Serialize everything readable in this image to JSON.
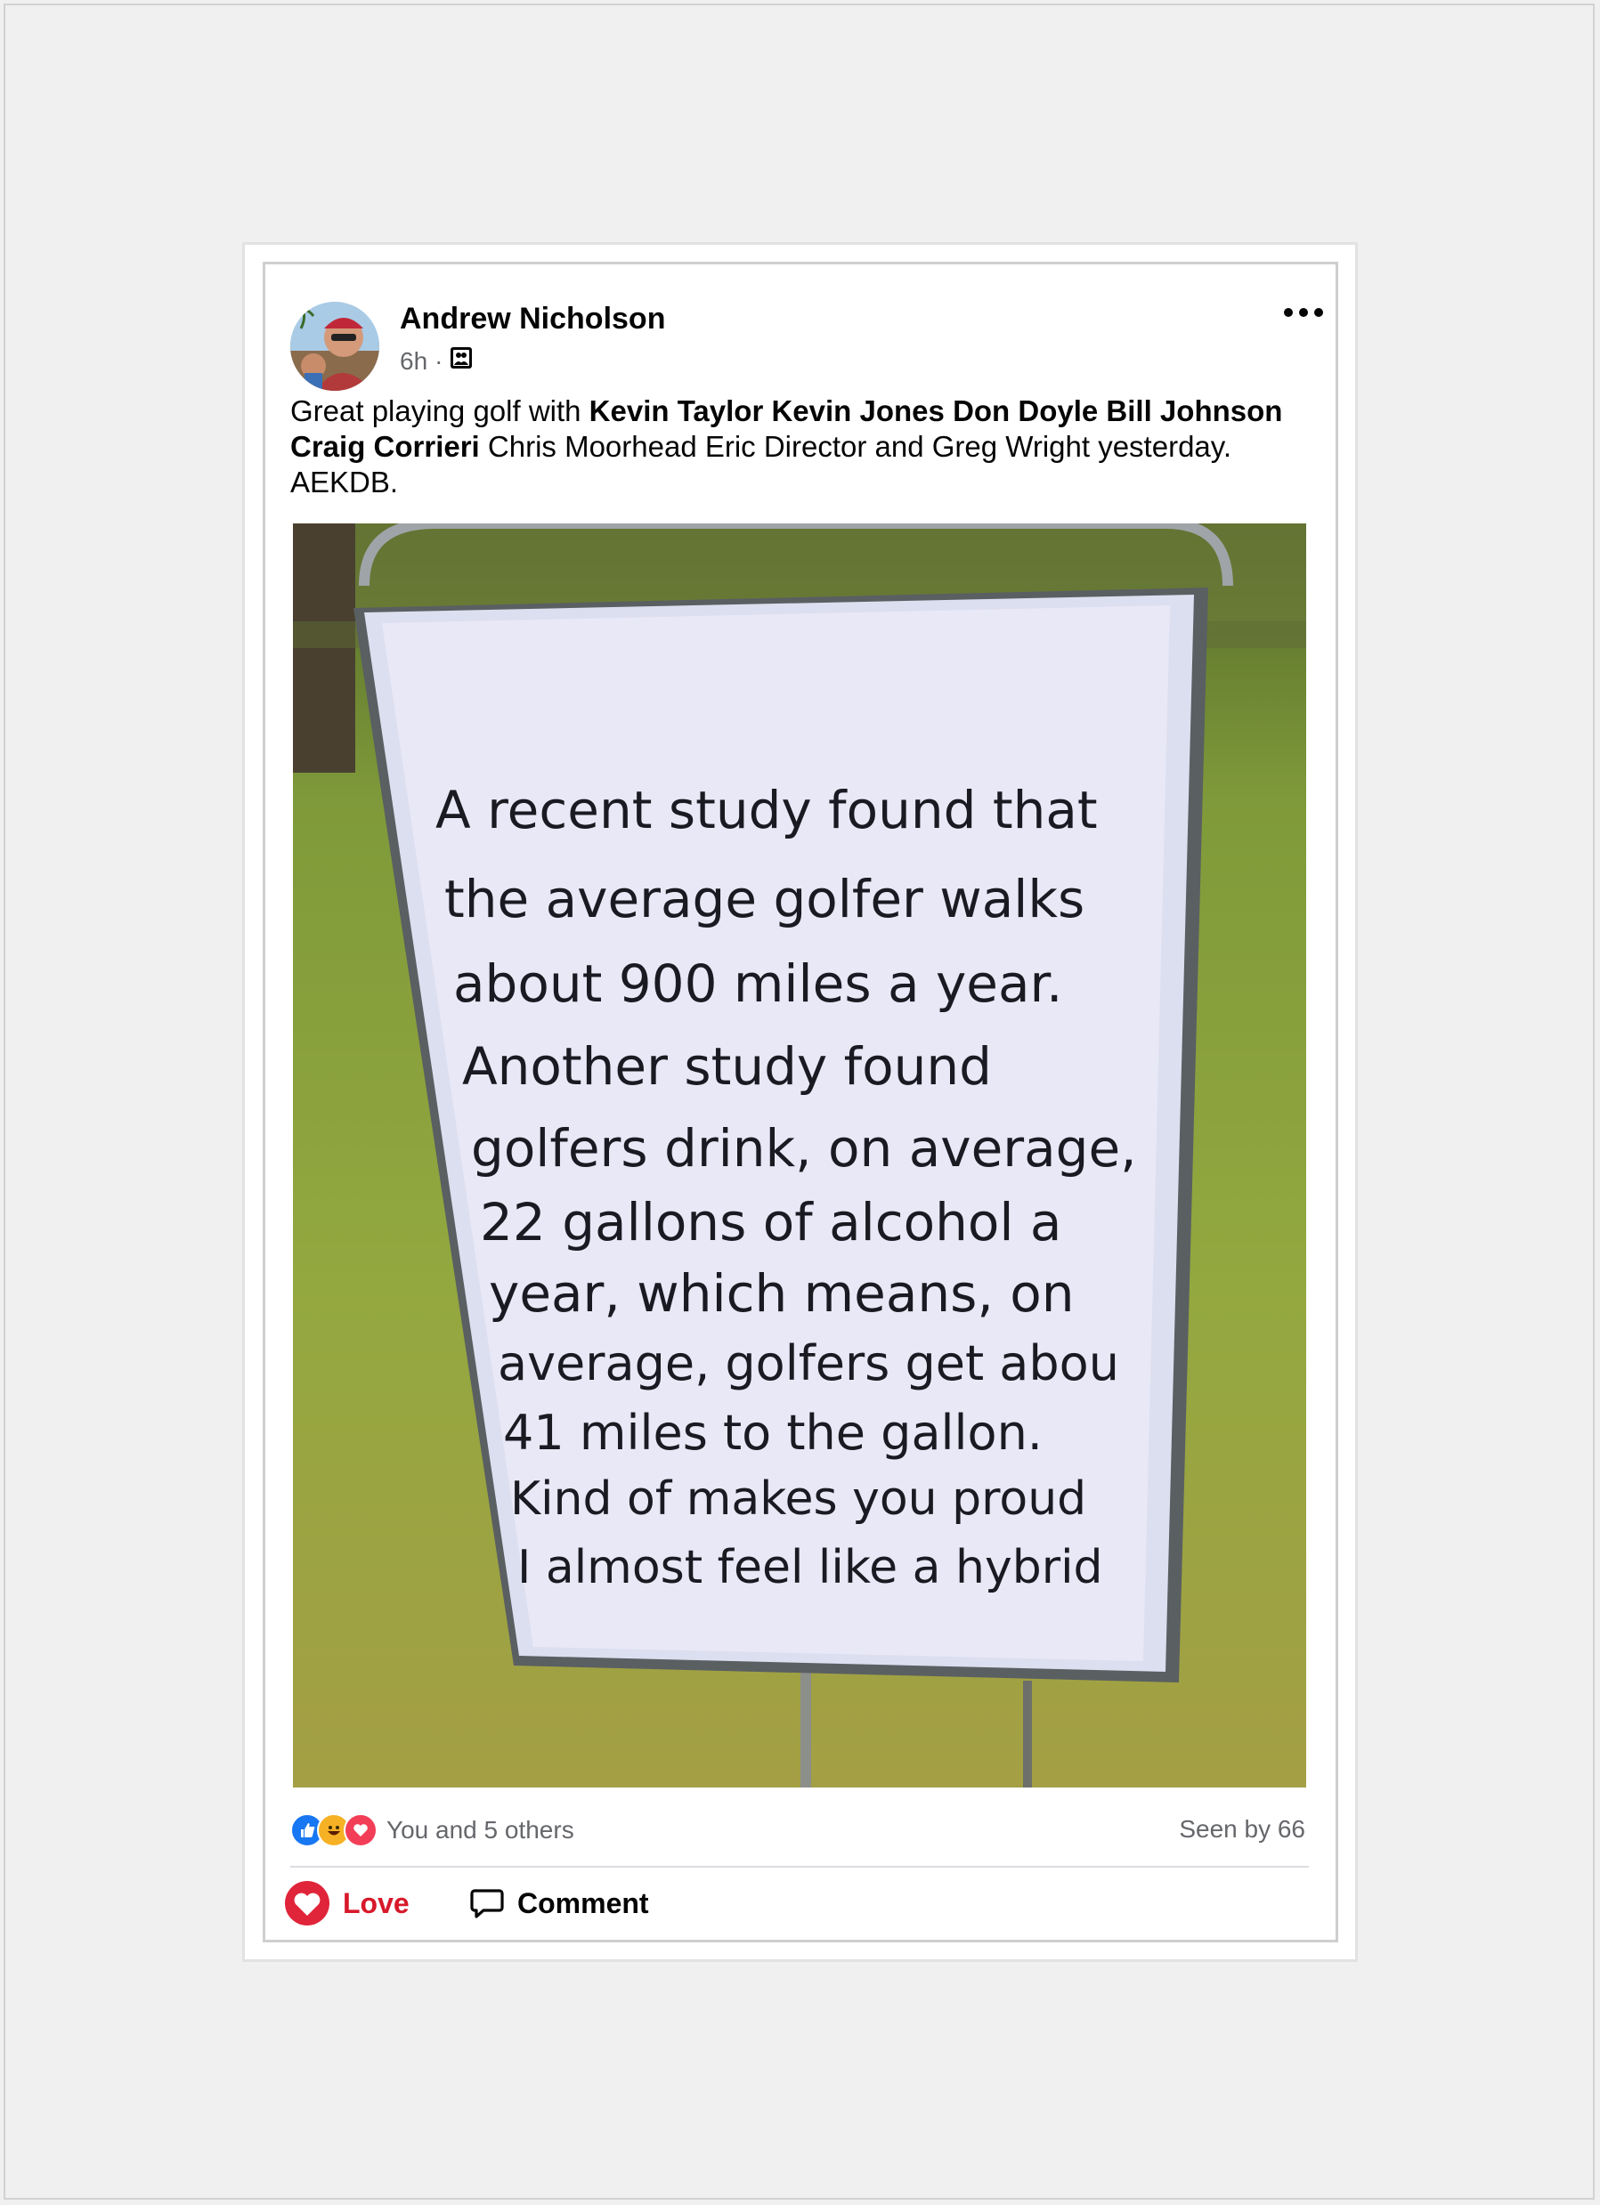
{
  "post": {
    "author": "Andrew Nicholson",
    "time": "6h",
    "separator": "·",
    "audience_icon": "friends-icon",
    "more_icon": "more-horizontal-icon",
    "caption": {
      "prefix": "Great playing golf with ",
      "tagged_bold": [
        "Kevin Taylor",
        "Kevin Jones",
        "Don Doyle",
        "Bill Johnson",
        "Craig Corrieri"
      ],
      "tagged_plain": "Chris Moorhead Eric Director and Greg Wright yesterday.",
      "suffix": "AEKDB."
    },
    "sign_text": [
      "A recent study found that",
      "the average golfer walks",
      "about 900 miles a year.",
      "Another study found",
      "golfers drink, on average,",
      "22 gallons of alcohol a",
      "year, which means, on",
      "average, golfers get abou",
      "41 miles to the gallon.",
      "Kind of makes you proud",
      "I almost feel like a hybrid"
    ]
  },
  "reactions": {
    "icons": [
      "like-icon",
      "haha-icon",
      "love-icon"
    ],
    "summary": "You and 5 others",
    "seen": "Seen by 66"
  },
  "actions": {
    "love_label": "Love",
    "comment_label": "Comment"
  },
  "colors": {
    "love": "#d7192a",
    "like": "#1877f2",
    "haha": "#f7b125",
    "text": "#050505",
    "muted": "#65676b"
  }
}
